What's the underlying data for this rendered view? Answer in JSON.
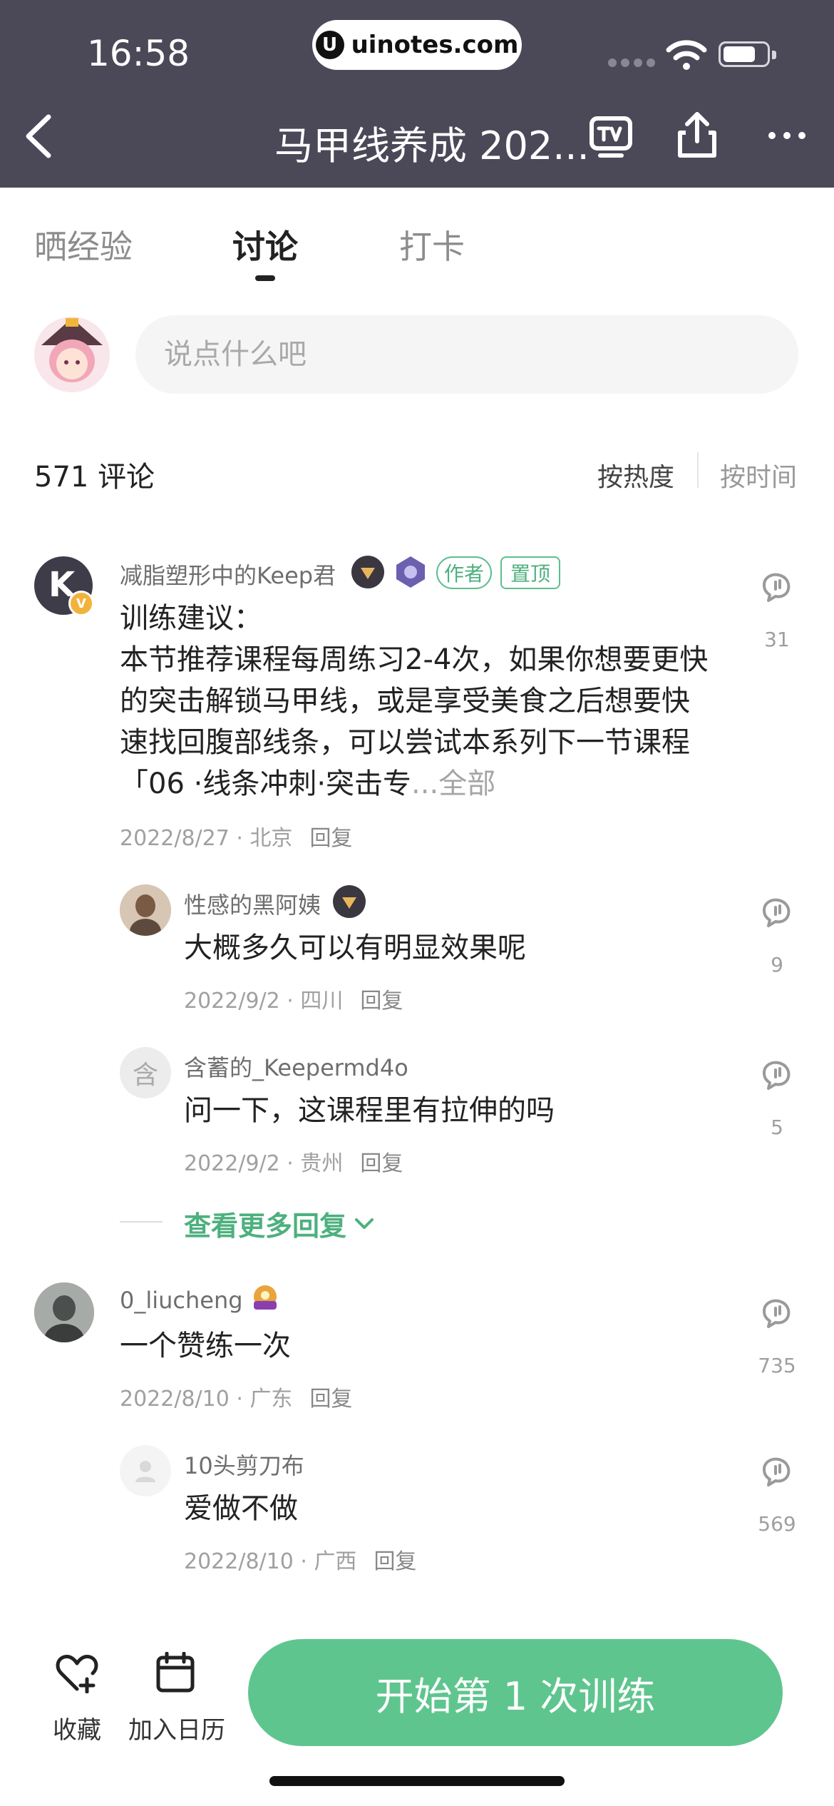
{
  "status_bar": {
    "time": "16:58",
    "url": "uinotes.com"
  },
  "nav": {
    "title": "马甲线养成 202..."
  },
  "tabs": [
    {
      "label": "晒经验",
      "active": false
    },
    {
      "label": "讨论",
      "active": true
    },
    {
      "label": "打卡",
      "active": false
    }
  ],
  "comment_input": {
    "placeholder": "说点什么吧"
  },
  "comments_header": {
    "count": "571 评论",
    "sort_hot": "按热度",
    "sort_time": "按时间"
  },
  "comments": [
    {
      "name": "减脂塑形中的Keep君",
      "tags": [
        "作者",
        "置顶"
      ],
      "text": "训练建议：\n本节推荐课程每周练习2-4次，如果你想要更快的突击解锁马甲线，或是享受美食之后想要快速找回腹部线条，可以尝试本系列下一节课程「06 ·线条冲刺·突击专",
      "more": "...全部",
      "date": "2022/8/27",
      "location": "北京",
      "reply": "回复",
      "likes": "31",
      "avatar_letter": "K"
    },
    {
      "name": "性感的黑阿姨",
      "text": "大概多久可以有明显效果呢",
      "date": "2022/9/2",
      "location": "四川",
      "reply": "回复",
      "likes": "9"
    },
    {
      "name": "含蓄的_Keepermd4o",
      "text": "问一下，这课程里有拉伸的吗",
      "date": "2022/9/2",
      "location": "贵州",
      "reply": "回复",
      "likes": "5",
      "avatar_letter": "含"
    },
    {
      "name": "0_liucheng",
      "text": "一个赞练一次",
      "date": "2022/8/10",
      "location": "广东",
      "reply": "回复",
      "likes": "735"
    },
    {
      "name": "10头剪刀布",
      "text": "爱做不做",
      "date": "2022/8/10",
      "location": "广西",
      "reply": "回复",
      "likes": "569"
    }
  ],
  "more_replies": "查看更多回复",
  "bottom_bar": {
    "favorite_label": "收藏",
    "calendar_label": "加入日历",
    "start_button": "开始第 1 次训练"
  },
  "colors": {
    "header_bg": "#4b4858",
    "accent_green": "#5fc58e"
  }
}
